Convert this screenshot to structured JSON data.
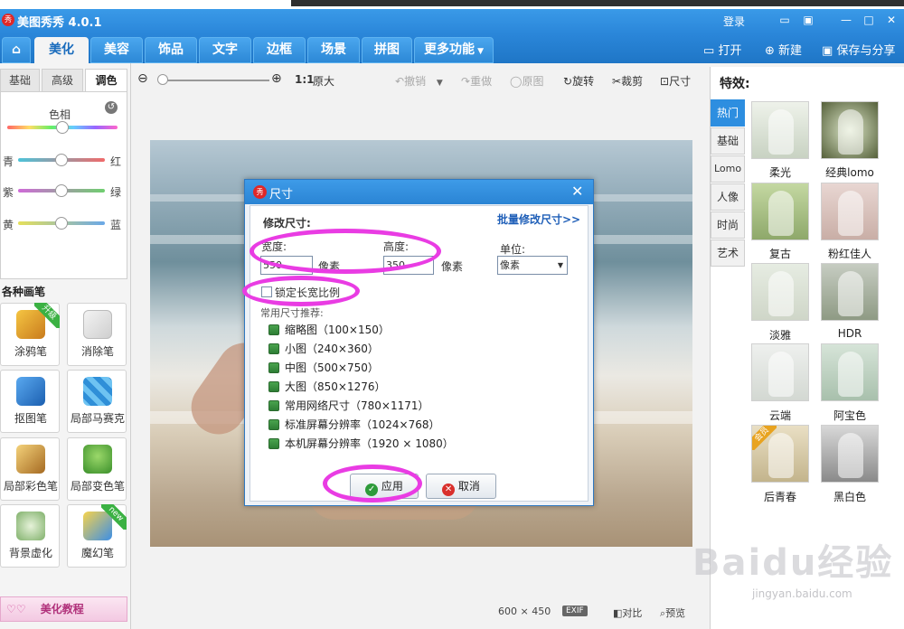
{
  "app": {
    "title": "美图秀秀 4.0.1",
    "logo_text": "秀",
    "login": "登录",
    "window_controls": [
      "chat-icon",
      "skin-icon",
      "minimize-icon",
      "maximize-icon",
      "close-icon"
    ]
  },
  "tabs": [
    {
      "label": "美化",
      "active": true
    },
    {
      "label": "美容"
    },
    {
      "label": "饰品"
    },
    {
      "label": "文字"
    },
    {
      "label": "边框"
    },
    {
      "label": "场景"
    },
    {
      "label": "拼图"
    },
    {
      "label": "更多功能"
    }
  ],
  "top_actions": {
    "open": "打开",
    "new": "新建",
    "save_share": "保存与分享"
  },
  "left_tabs": [
    "基础",
    "高级",
    "调色"
  ],
  "adjust": {
    "hue_label": "色相",
    "hue_level": 0.5,
    "balance": [
      {
        "left": "青",
        "right": "红",
        "level": 0.5
      },
      {
        "left": "紫",
        "right": "绿",
        "level": 0.5
      },
      {
        "left": "黄",
        "right": "蓝",
        "level": 0.5
      }
    ]
  },
  "brushes": {
    "title": "各种画笔",
    "items": [
      {
        "label": "涂鸦笔",
        "badge": "升级"
      },
      {
        "label": "消除笔"
      },
      {
        "label": "抠图笔"
      },
      {
        "label": "局部马赛克"
      },
      {
        "label": "局部彩色笔"
      },
      {
        "label": "局部变色笔"
      },
      {
        "label": "背景虚化"
      },
      {
        "label": "魔幻笔",
        "badge": "new"
      }
    ]
  },
  "tutorial": "美化教程",
  "toolbar": {
    "zoom_ratio": "1:1",
    "original_size": "原大",
    "undo": "撤销",
    "redo": "重做",
    "original": "原图",
    "rotate": "旋转",
    "crop": "裁剪",
    "size": "尺寸"
  },
  "status": {
    "dimensions": "600 × 450",
    "exif": "EXIF",
    "compare": "对比",
    "preview": "预览"
  },
  "dialog": {
    "title": "尺寸",
    "title_logo": "秀",
    "section": "修改尺寸:",
    "batch_link": "批量修改尺寸>>",
    "width_label": "宽度:",
    "width_value": "550",
    "width_unit": "像素",
    "height_label": "高度:",
    "height_value": "350",
    "height_unit": "像素",
    "unit_label": "单位:",
    "unit_value": "像素",
    "lock_ratio": "锁定长宽比例",
    "lock_checked": false,
    "presets_title": "常用尺寸推荐:",
    "presets": [
      "缩略图（100×150）",
      "小图（240×360）",
      "中图（500×750）",
      "大图（850×1276）",
      "常用网络尺寸（780×1171）",
      "标准屏幕分辨率（1024×768）",
      "本机屏幕分辨率（1920 × 1080）"
    ],
    "apply": "应用",
    "cancel": "取消"
  },
  "effects": {
    "title": "特效:",
    "categories": [
      "热门",
      "基础",
      "Lomo",
      "人像",
      "时尚",
      "艺术"
    ],
    "active_category": "热门",
    "items": [
      {
        "label": "柔光"
      },
      {
        "label": "经典lomo"
      },
      {
        "label": "复古"
      },
      {
        "label": "粉红佳人"
      },
      {
        "label": "淡雅"
      },
      {
        "label": "HDR"
      },
      {
        "label": "云端"
      },
      {
        "label": "阿宝色"
      },
      {
        "label": "后青春",
        "badge": "会员"
      },
      {
        "label": "黑白色"
      }
    ]
  },
  "watermark": {
    "logo": "Baidu经验",
    "url": "jingyan.baidu.com"
  },
  "colors": {
    "brand_blue": "#2a86d9",
    "highlight_magenta": "#e93ce3",
    "apply_green": "#2e9b3a",
    "cancel_red": "#d9302c"
  }
}
